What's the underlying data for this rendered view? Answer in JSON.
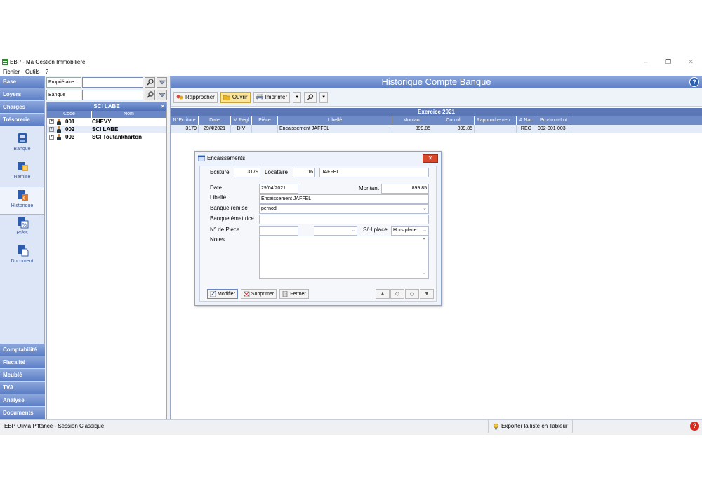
{
  "window": {
    "title": "EBP - Ma Gestion Immobilière",
    "min": "–",
    "max": "❐",
    "close": "✕"
  },
  "menu": [
    "Fichier",
    "Outils",
    "?"
  ],
  "nav": {
    "top": [
      "Base",
      "Loyers",
      "Charges",
      "Trésorerie"
    ],
    "icons": [
      {
        "label": "Banque"
      },
      {
        "label": "Remise"
      },
      {
        "label": "Historique"
      },
      {
        "label": "Prêts"
      },
      {
        "label": "Document"
      }
    ],
    "bottom": [
      "Comptabilité",
      "Fiscalité",
      "Meublé",
      "TVA",
      "Analyse",
      "Documents"
    ]
  },
  "filters": {
    "owner_label": "Propriétaire",
    "bank_label": "Banque"
  },
  "tree": {
    "title": "SCI LABE",
    "close": "×",
    "col_code": "Code",
    "col_name": "Nom",
    "rows": [
      {
        "code": "001",
        "name": "CHEVY"
      },
      {
        "code": "002",
        "name": "SCI LABE"
      },
      {
        "code": "003",
        "name": "SCI Toutankharton"
      }
    ]
  },
  "main": {
    "title": "Historique Compte Banque",
    "help": "?",
    "toolbar": {
      "rapprocher": "Rapprocher",
      "ouvrir": "Ouvrir",
      "imprimer": "Imprimer"
    },
    "grid_title": "Exercice 2021",
    "columns": [
      "N°Ecriture",
      "Date",
      "M.Régl",
      "Pièce",
      "Libellé",
      "Montant",
      "Cumul",
      "Rapprochemen...",
      "A.Nat.",
      "Pro-Imm-Lot"
    ],
    "rows": [
      [
        "3179",
        "29/4/2021",
        "DIV",
        "",
        "Encaissement JAFFEL",
        "899.85",
        "899.85",
        "",
        "REG",
        "002-001-003"
      ]
    ]
  },
  "dialog": {
    "title": "Encaissements",
    "close": "✕",
    "ecriture_label": "Ecriture",
    "ecriture_value": "3179",
    "locataire_label": "Locataire",
    "locataire_num": "16",
    "locataire_name": "JAFFEL",
    "date_label": "Date",
    "date_value": "29/04/2021",
    "montant_label": "Montant",
    "montant_value": "899.85",
    "libelle_label": "Libellé",
    "libelle_value": "Encaissement JAFFEL",
    "banque_remise_label": "Banque remise",
    "banque_remise_value": "pernod",
    "banque_emettrice_label": "Banque émettrice",
    "piece_label": "N° de Pièce",
    "sh_label": "S/H place",
    "sh_value": "Hors place",
    "notes_label": "Notes",
    "btn_modifier": "Modifier",
    "btn_supprimer": "Supprimer",
    "btn_fermer": "Fermer"
  },
  "status": {
    "user": "EBP Olivia Pittance - Session Classique",
    "export": "Exporter la liste en Tableur"
  },
  "colors": {
    "accent": "#5b7ec6",
    "nav_bg": "#dde6f6",
    "highlight": "#fde69a"
  }
}
